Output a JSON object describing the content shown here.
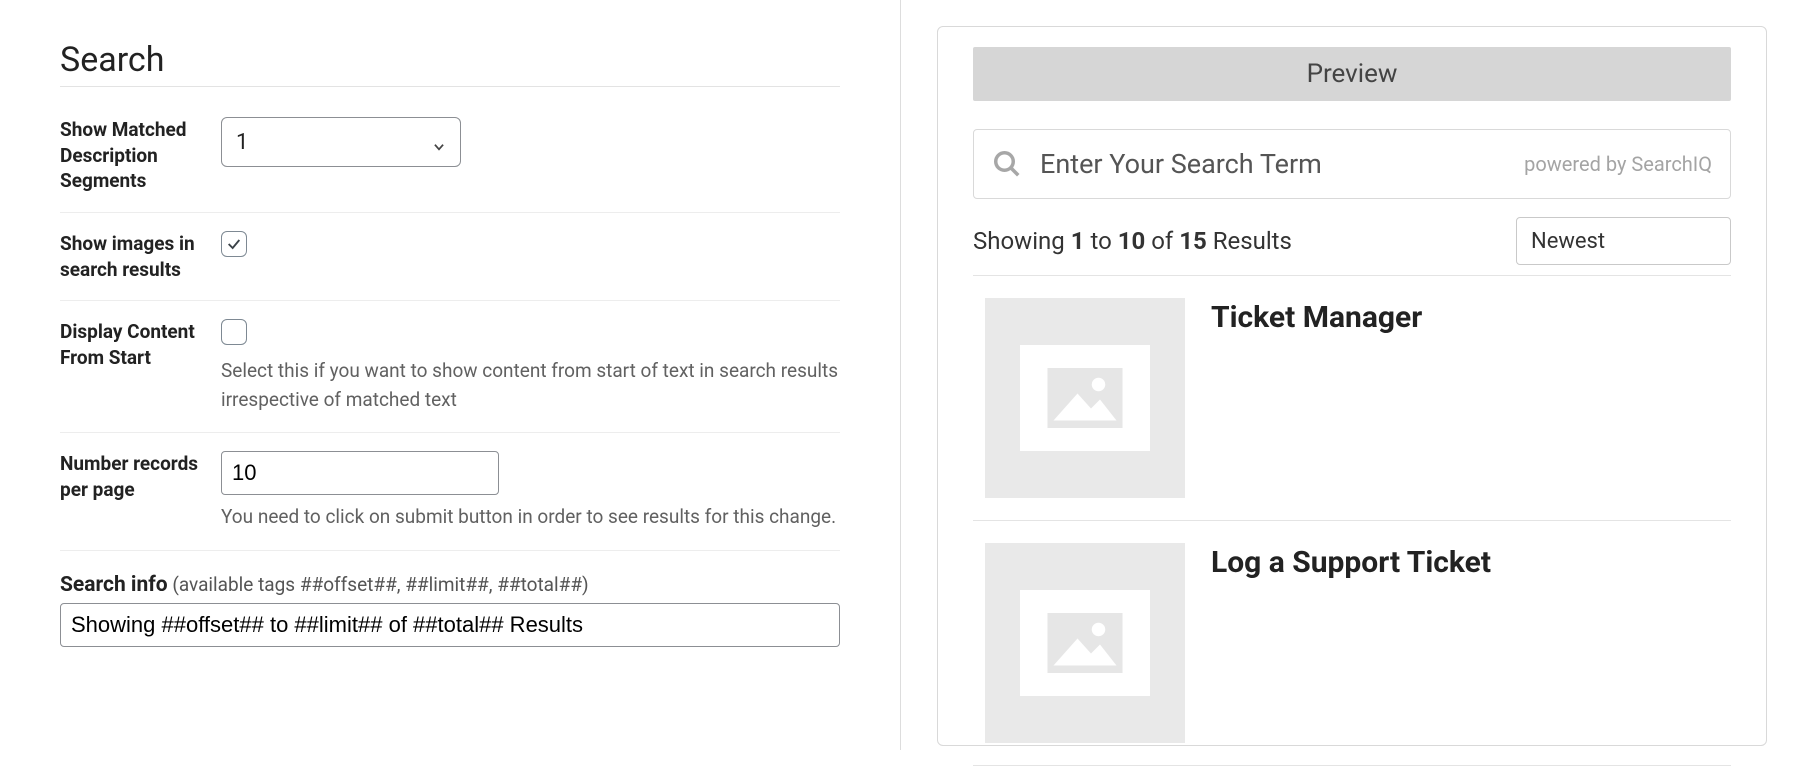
{
  "left": {
    "title": "Search",
    "segments_label": "Show Matched Description Segments",
    "segments_value": "1",
    "show_images_label": "Show images in search results",
    "show_images_checked": true,
    "content_start_label": "Display Content From Start",
    "content_start_help": "Select this if you want to show content from start of text in search results irrespective of matched text",
    "content_start_checked": false,
    "records_label": "Number records per page",
    "records_value": "10",
    "records_help": "You need to click on submit button in order to see results for this change.",
    "search_info_label": "Search info",
    "search_info_hint": " (available tags ##offset##, ##limit##, ##total##)",
    "search_info_value": "Showing ##offset## to ##limit## of ##total## Results"
  },
  "preview": {
    "header": "Preview",
    "placeholder": "Enter Your Search Term",
    "powered": "powered by SearchIQ",
    "showing_prefix": "Showing ",
    "showing_from": "1",
    "showing_to_word": " to ",
    "showing_to": "10",
    "showing_of_word": " of ",
    "showing_total": "15",
    "showing_suffix": " Results",
    "sort_value": "Newest",
    "results": [
      {
        "title": "Ticket Manager"
      },
      {
        "title": "Log a Support Ticket"
      }
    ]
  }
}
